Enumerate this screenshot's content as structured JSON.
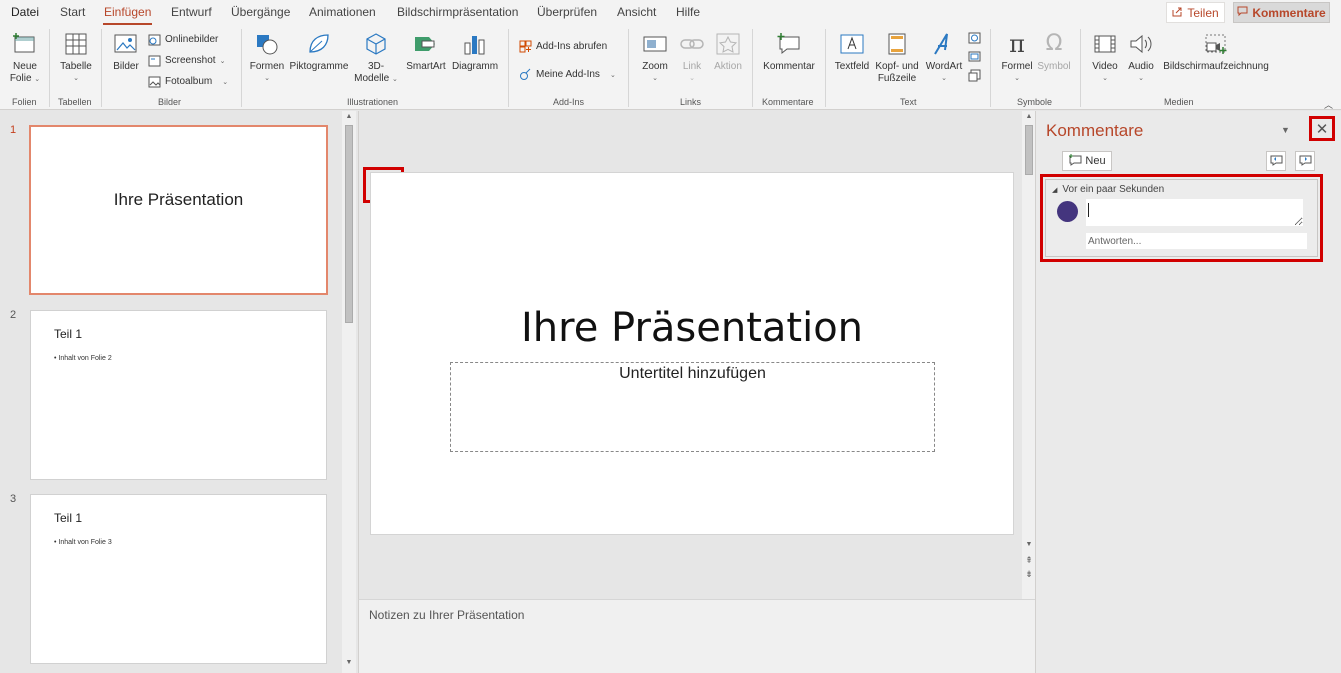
{
  "menu": {
    "tabs": [
      "Datei",
      "Start",
      "Einfügen",
      "Entwurf",
      "Übergänge",
      "Animationen",
      "Bildschirmpräsentation",
      "Überprüfen",
      "Ansicht",
      "Hilfe"
    ],
    "active": "Einfügen",
    "share_label": "Teilen",
    "comments_label": "Kommentare"
  },
  "ribbon": {
    "groups": {
      "folien": "Folien",
      "tabellen": "Tabellen",
      "bilder": "Bilder",
      "illustrationen": "Illustrationen",
      "addins": "Add-Ins",
      "links": "Links",
      "kommentare": "Kommentare",
      "text": "Text",
      "symbole": "Symbole",
      "medien": "Medien"
    },
    "buttons": {
      "neue_folie_1": "Neue",
      "neue_folie_2": "Folie",
      "tabelle": "Tabelle",
      "bilder": "Bilder",
      "onlinebilder": "Onlinebilder",
      "screenshot": "Screenshot",
      "fotoalbum": "Fotoalbum",
      "formen": "Formen",
      "piktogramme": "Piktogramme",
      "modelle_1": "3D-",
      "modelle_2": "Modelle",
      "smartart": "SmartArt",
      "diagramm": "Diagramm",
      "addins_abrufen": "Add-Ins abrufen",
      "meine_addins": "Meine Add-Ins",
      "zoom": "Zoom",
      "link": "Link",
      "aktion": "Aktion",
      "kommentar": "Kommentar",
      "textfeld": "Textfeld",
      "kopf_1": "Kopf- und",
      "kopf_2": "Fußzeile",
      "wordart": "WordArt",
      "formel": "Formel",
      "symbol": "Symbol",
      "video": "Video",
      "audio": "Audio",
      "bildschirmaufzeichnung": "Bildschirmaufzeichnung"
    }
  },
  "slides": [
    {
      "number": "1",
      "title": "Ihre Präsentation",
      "bullet": ""
    },
    {
      "number": "2",
      "title": "Teil 1",
      "bullet": "• Inhalt von Folie 2"
    },
    {
      "number": "3",
      "title": "Teil 1",
      "bullet": "• Inhalt von Folie 3"
    }
  ],
  "main": {
    "title": "Ihre Präsentation",
    "subtitle": "Untertitel hinzufügen",
    "notes": "Notizen zu Ihrer Präsentation"
  },
  "comments_pane": {
    "title": "Kommentare",
    "new_label": "Neu",
    "comment_time": "Vor ein paar Sekunden",
    "reply_placeholder": "Antworten..."
  },
  "colors": {
    "accent": "#b7472a",
    "highlight": "#d10000",
    "avatar": "#44357e"
  }
}
